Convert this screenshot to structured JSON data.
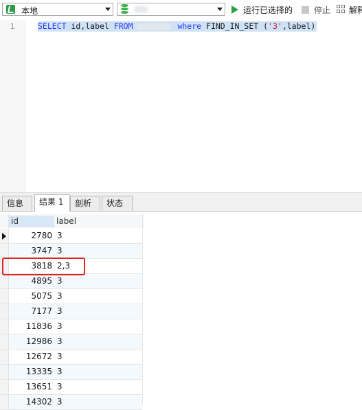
{
  "toolbar": {
    "connection": "本地",
    "database": "",
    "run_selected": "运行已选择的",
    "stop": "停止",
    "explain": "解释"
  },
  "editor": {
    "line_number": "1",
    "query": {
      "select": "SELECT",
      "columns": "id,label",
      "from": "FROM",
      "where": "where",
      "func": "FIND_IN_SET (",
      "str": "'3'",
      "rest": ",label)"
    }
  },
  "tabs": [
    "信息",
    "结果 1",
    "剖析",
    "状态"
  ],
  "active_tab": "结果 1",
  "result": {
    "columns": [
      "id",
      "label"
    ],
    "rows": [
      {
        "id": "2780",
        "label": "3"
      },
      {
        "id": "3747",
        "label": "3"
      },
      {
        "id": "3818",
        "label": "2,3"
      },
      {
        "id": "4895",
        "label": "3"
      },
      {
        "id": "5075",
        "label": "3"
      },
      {
        "id": "7177",
        "label": "3"
      },
      {
        "id": "11836",
        "label": "3"
      },
      {
        "id": "12986",
        "label": "3"
      },
      {
        "id": "12672",
        "label": "3"
      },
      {
        "id": "13335",
        "label": "3"
      },
      {
        "id": "13651",
        "label": "3"
      },
      {
        "id": "14302",
        "label": "3"
      }
    ],
    "highlighted_row_id": "3818"
  },
  "colors": {
    "keyword": "#2a3bff",
    "string": "#c42727",
    "selection": "#cfe1f5",
    "highlight_box": "#e02424",
    "run_green": "#2ea043"
  }
}
